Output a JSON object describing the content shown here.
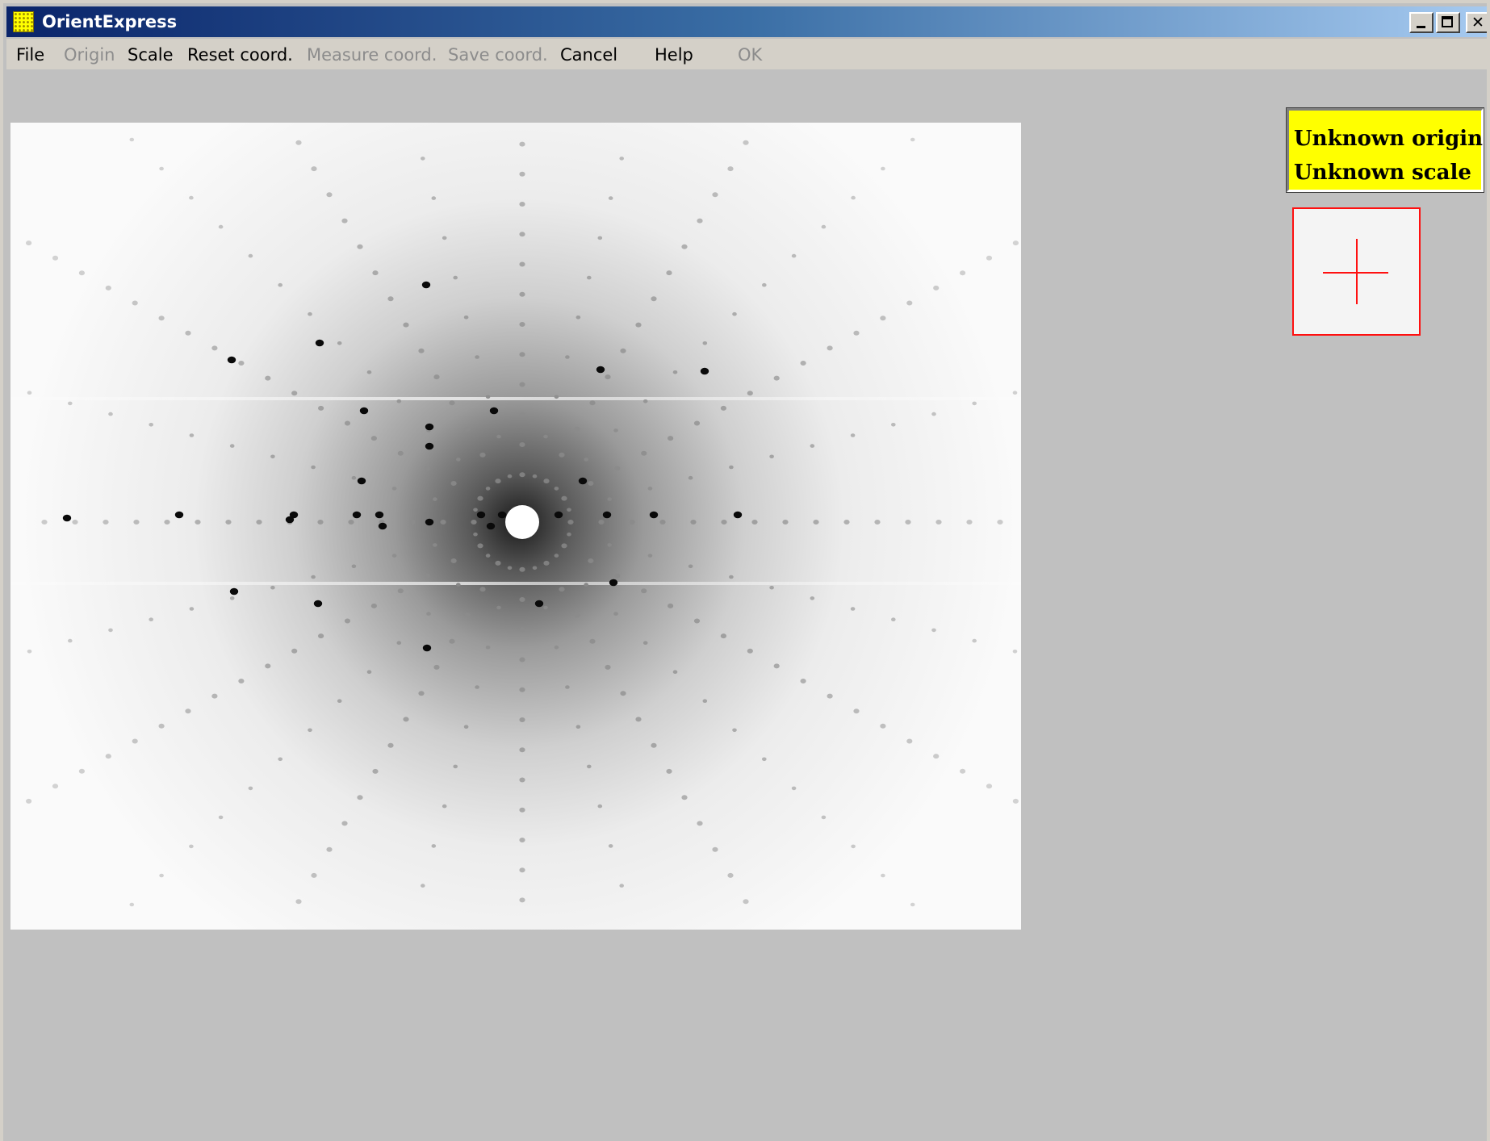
{
  "window": {
    "title": "OrientExpress",
    "controls": {
      "minimize_glyph": "",
      "maximize_glyph": "",
      "close_glyph": "✕"
    }
  },
  "menu": {
    "items": [
      {
        "label": "File",
        "enabled": true
      },
      {
        "label": "Origin",
        "enabled": false
      },
      {
        "label": "Scale",
        "enabled": true
      },
      {
        "label": "Reset coord.",
        "enabled": true
      },
      {
        "label": "Measure coord.",
        "enabled": false
      },
      {
        "label": "Save coord.",
        "enabled": false
      },
      {
        "label": "Cancel",
        "enabled": true
      },
      {
        "label": "Help",
        "enabled": true
      },
      {
        "label": "OK",
        "enabled": false
      }
    ]
  },
  "status": {
    "origin": "Unknown origin",
    "scale": "Unknown scale"
  },
  "icons": {
    "app": "orientexpress-app-icon",
    "crosshair": "crosshair-icon"
  },
  "colors": {
    "status_background": "#ffff00",
    "crosshair": "#ff1010",
    "titlebar_start": "#0a246a",
    "titlebar_end": "#a6caf0"
  }
}
